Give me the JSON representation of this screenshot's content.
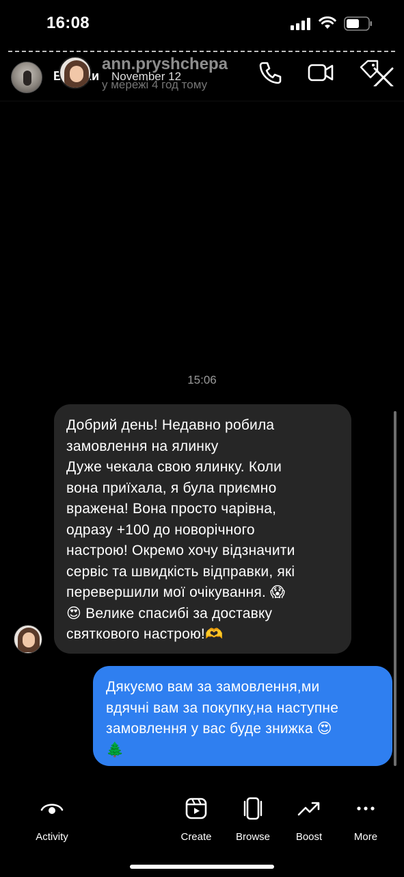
{
  "status_bar": {
    "time": "16:08"
  },
  "story": {
    "owner_name": "Відгуки",
    "date": "November 12"
  },
  "chat_header": {
    "username": "ann.pryshchepa",
    "status": "у мережі 4 год тому",
    "icons": [
      "phone-icon",
      "video-icon",
      "tag-icon",
      "close-icon"
    ]
  },
  "conversation": {
    "timestamp": "15:06",
    "incoming_message": {
      "lines": [
        "Добрий день! Недавно робила",
        "замовлення на ялинку",
        "Дуже чекала свою ялинку. Коли",
        "вона приїхала, я була приємно",
        "вражена! Вона просто чарівна,",
        "одразу +100 до новорічного",
        "настрою! Окремо хочу відзначити",
        "сервіс та швидкість відправки, які",
        "перевершили мої очікування. 😱",
        "😍  Велике спасибі за доставку",
        "святкового настрою!🫶"
      ]
    },
    "outgoing_message": {
      "lines": [
        "Дякуємо вам за  замовлення,ми",
        "вдячні вам за покупку,на наступне",
        "замовлення у вас буде знижка 😍",
        "🌲"
      ]
    }
  },
  "bottom_bar": {
    "items": [
      {
        "label": "Activity",
        "icon": "eye-icon"
      },
      {
        "label": "Create",
        "icon": "reels-icon"
      },
      {
        "label": "Browse",
        "icon": "browse-icon"
      },
      {
        "label": "Boost",
        "icon": "trending-icon"
      },
      {
        "label": "More",
        "icon": "more-icon"
      }
    ]
  },
  "colors": {
    "background": "#000000",
    "incoming_bubble": "#262626",
    "outgoing_bubble": "#2f7ff0"
  }
}
